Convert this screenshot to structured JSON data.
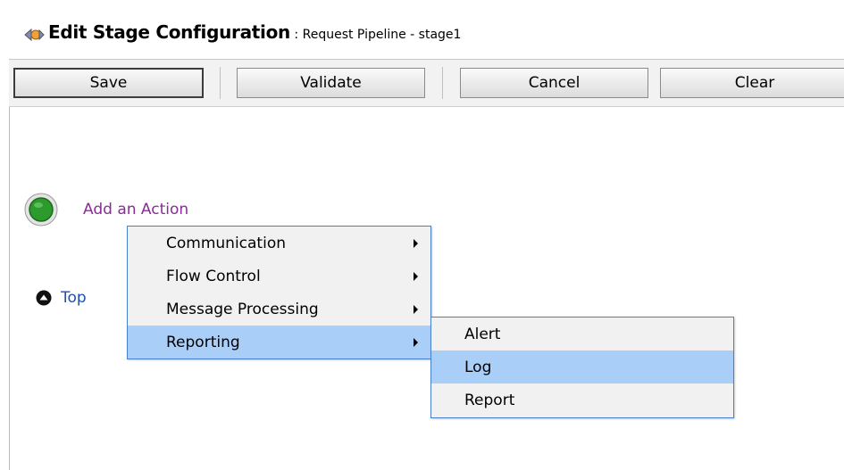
{
  "header": {
    "title": "Edit Stage Configuration",
    "separator": " : ",
    "subtitle": "Request Pipeline - stage1",
    "icon": "stage-config-icon"
  },
  "toolbar": {
    "save_label": "Save",
    "validate_label": "Validate",
    "cancel_label": "Cancel",
    "clear_label": "Clear"
  },
  "stage": {
    "add_action_label": "Add an Action",
    "top_link_label": "Top",
    "status_color": "#2c9a2c"
  },
  "context_menu": {
    "items": [
      {
        "label": "Communication",
        "has_submenu": true
      },
      {
        "label": "Flow Control",
        "has_submenu": true
      },
      {
        "label": "Message Processing",
        "has_submenu": true
      },
      {
        "label": "Reporting",
        "has_submenu": true,
        "highlighted": true
      }
    ]
  },
  "submenu": {
    "items": [
      {
        "label": "Alert"
      },
      {
        "label": "Log",
        "highlighted": true
      },
      {
        "label": "Report"
      }
    ]
  }
}
